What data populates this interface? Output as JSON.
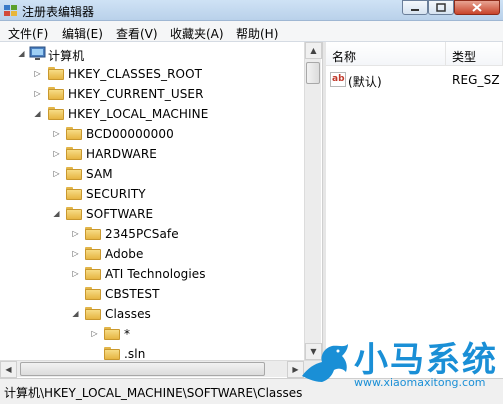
{
  "window": {
    "title": "注册表编辑器",
    "app_icon": "regedit-icon",
    "controls": [
      "minimize-icon",
      "maximize-icon",
      "close-icon"
    ]
  },
  "menu": {
    "items": [
      "文件(F)",
      "编辑(E)",
      "查看(V)",
      "收藏夹(A)",
      "帮助(H)"
    ]
  },
  "tree": {
    "nodes": [
      {
        "label": "计算机",
        "level": 0,
        "state": "expanded",
        "icon": "computer-icon"
      },
      {
        "label": "HKEY_CLASSES_ROOT",
        "level": 1,
        "state": "collapsed",
        "icon": "folder-icon"
      },
      {
        "label": "HKEY_CURRENT_USER",
        "level": 1,
        "state": "collapsed",
        "icon": "folder-icon"
      },
      {
        "label": "HKEY_LOCAL_MACHINE",
        "level": 1,
        "state": "expanded",
        "icon": "folder-icon"
      },
      {
        "label": "BCD00000000",
        "level": 2,
        "state": "collapsed",
        "icon": "folder-icon"
      },
      {
        "label": "HARDWARE",
        "level": 2,
        "state": "collapsed",
        "icon": "folder-icon"
      },
      {
        "label": "SAM",
        "level": 2,
        "state": "collapsed",
        "icon": "folder-icon"
      },
      {
        "label": "SECURITY",
        "level": 2,
        "state": "none",
        "icon": "folder-icon"
      },
      {
        "label": "SOFTWARE",
        "level": 2,
        "state": "expanded",
        "icon": "folder-icon"
      },
      {
        "label": "2345PCSafe",
        "level": 3,
        "state": "collapsed",
        "icon": "folder-icon"
      },
      {
        "label": "Adobe",
        "level": 3,
        "state": "collapsed",
        "icon": "folder-icon"
      },
      {
        "label": "ATI Technologies",
        "level": 3,
        "state": "collapsed",
        "icon": "folder-icon"
      },
      {
        "label": "CBSTEST",
        "level": 3,
        "state": "none",
        "icon": "folder-icon"
      },
      {
        "label": "Classes",
        "level": 3,
        "state": "expanded",
        "icon": "folder-icon"
      },
      {
        "label": "*",
        "level": 4,
        "state": "collapsed",
        "icon": "folder-icon"
      },
      {
        "label": ".sln",
        "level": 4,
        "state": "none",
        "icon": "folder-icon"
      }
    ]
  },
  "values_pane": {
    "columns": [
      "名称",
      "类型"
    ],
    "rows": [
      {
        "name": "(默认)",
        "type": "REG_SZ",
        "icon": "string-value-icon"
      }
    ]
  },
  "status": {
    "path": "计算机\\HKEY_LOCAL_MACHINE\\SOFTWARE\\Classes"
  },
  "watermark": {
    "title": "小马系统",
    "url": "www.xiaomaxitong.com",
    "icon": "horse-logo-icon"
  },
  "colors": {
    "folder": "#e6b542",
    "watermark": "#1a8fd6"
  }
}
